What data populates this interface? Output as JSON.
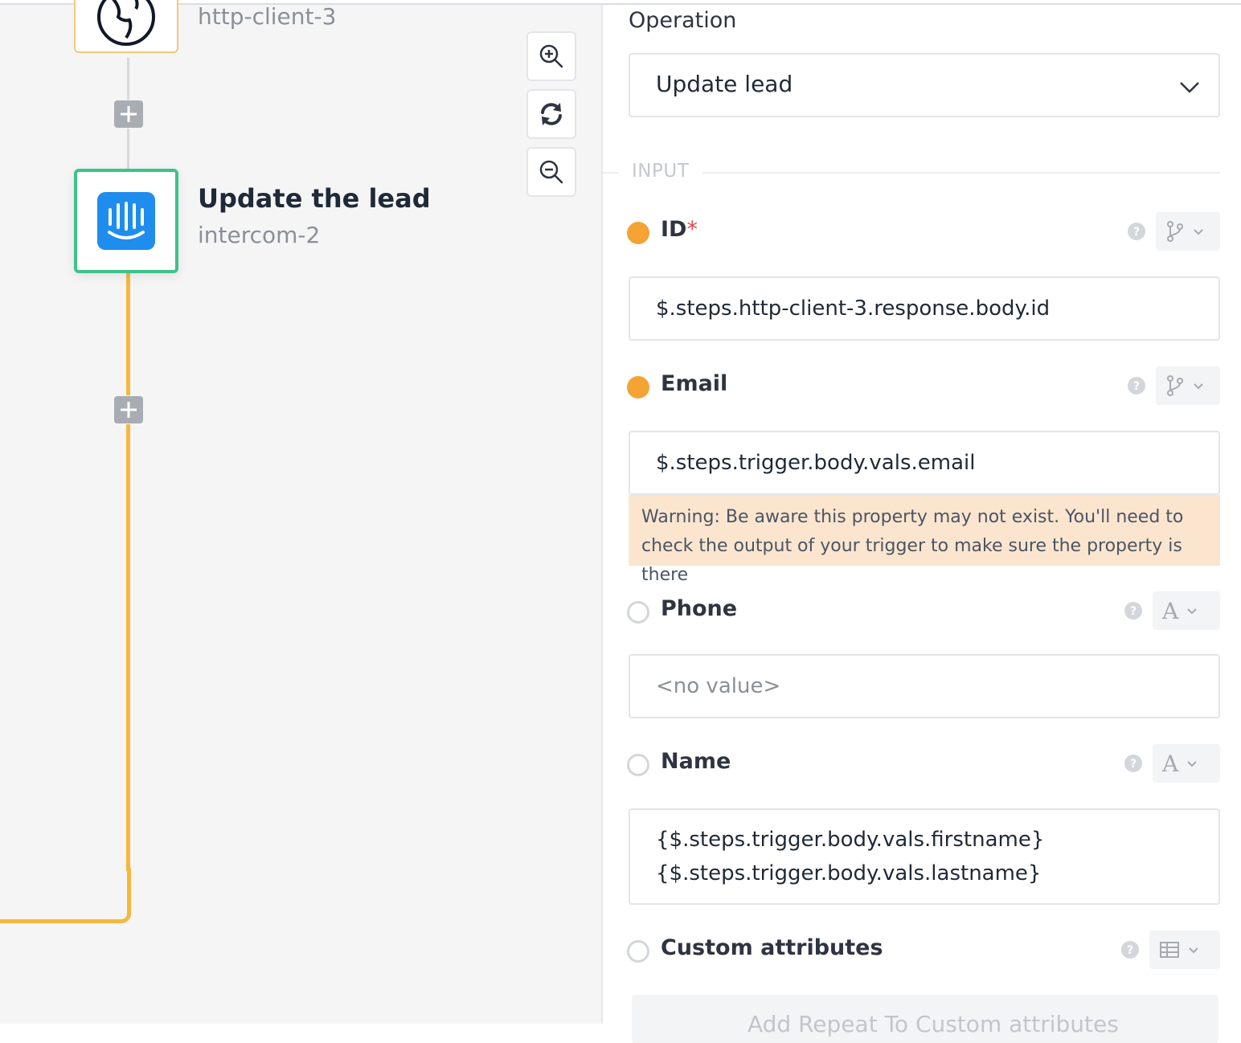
{
  "canvas": {
    "top_node": {
      "subtitle": "http-client-3"
    },
    "active_node": {
      "title": "Update the lead",
      "subtitle": "intercom-2"
    }
  },
  "toolbar": {
    "zoom_in": "zoom-in",
    "refresh": "refresh",
    "zoom_out": "zoom-out"
  },
  "panel": {
    "operation_label": "Operation",
    "operation_value": "Update lead",
    "section_label": "INPUT",
    "fields": {
      "id": {
        "label": "ID",
        "required": "*",
        "value": "$.steps.http-client-3.response.body.id"
      },
      "email": {
        "label": "Email",
        "value": "$.steps.trigger.body.vals.email"
      },
      "warning": {
        "line1": "Warning: Be aware this property may not exist. You'll need to",
        "line2": "check the output of your trigger to make sure the property is there"
      },
      "phone": {
        "label": "Phone",
        "type_symbol": "A",
        "placeholder": "<no value>"
      },
      "name": {
        "label": "Name",
        "type_symbol": "A",
        "line1": "{$.steps.trigger.body.vals.firstname}",
        "line2": "{$.steps.trigger.body.vals.lastname}"
      },
      "custom": {
        "label": "Custom attributes",
        "add_button": "Add Repeat To Custom attributes"
      }
    }
  },
  "colors": {
    "accent_orange": "#f6b73c",
    "active_green": "#3fc28a",
    "intercom_blue": "#1f8ded",
    "set_dot": "#f5a335",
    "warning_bg": "#fbe5cf",
    "required_red": "#e2474b"
  },
  "icons": [
    "plus-icon",
    "intercom-logo-icon",
    "zoom-in-icon",
    "refresh-icon",
    "zoom-out-icon",
    "chevron-down-icon",
    "help-icon",
    "branch-icon",
    "text-type-icon",
    "table-icon",
    "http-client-icon"
  ]
}
